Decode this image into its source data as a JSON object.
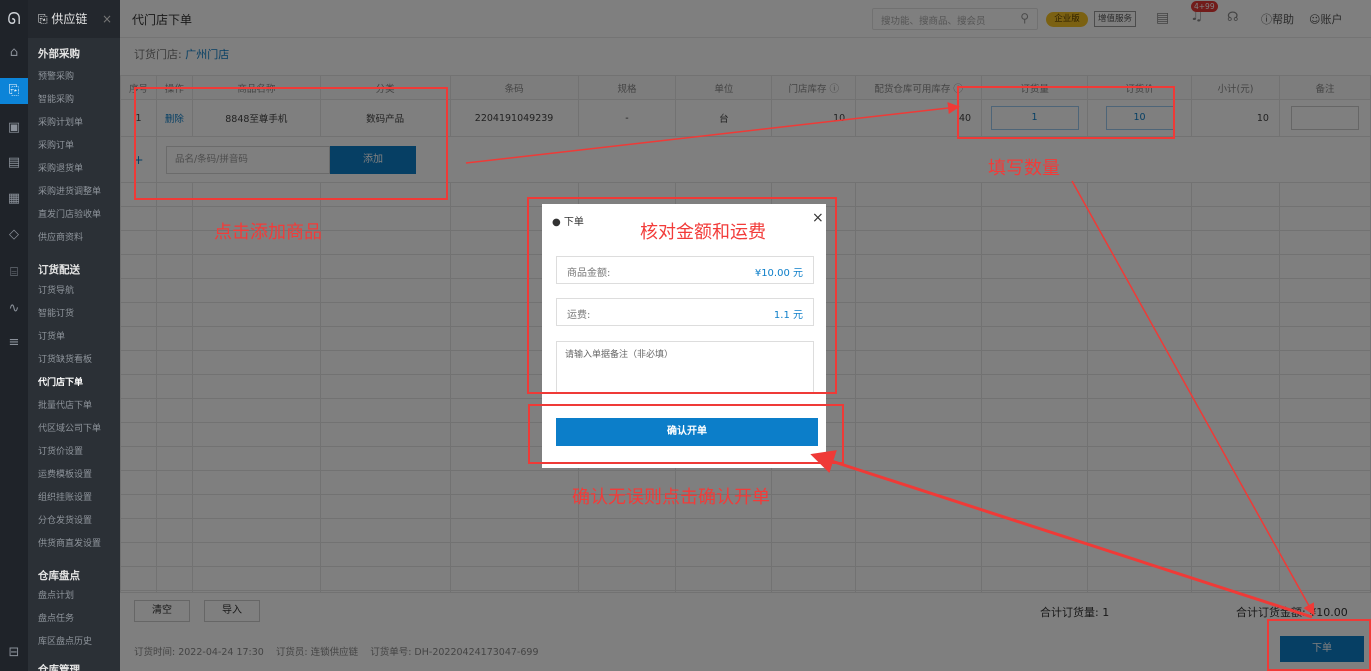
{
  "topbar": {
    "app_tab": "供应链",
    "page_title": "代门店下单",
    "search_placeholder": "搜功能、搜商品、搜会员",
    "edition_badge": "企业版",
    "value_added": "增值服务",
    "notif_badge": "4+99",
    "help": "帮助",
    "account": "账户"
  },
  "sidebar": {
    "groups": [
      {
        "title": "外部采购",
        "items": [
          "预警采购",
          "智能采购",
          "采购计划单",
          "采购订单",
          "采购退货单",
          "采购进货调整单",
          "直发门店验收单",
          "供应商资料"
        ]
      },
      {
        "title": "订货配送",
        "items": [
          "订货导航",
          "智能订货",
          "订货单",
          "订货缺货看板",
          "代门店下单",
          "批量代店下单",
          "代区域公司下单",
          "订货价设置",
          "运费模板设置",
          "组织挂账设置",
          "分仓发货设置",
          "供货商直发设置"
        ]
      },
      {
        "title": "仓库盘点",
        "items": [
          "盘点计划",
          "盘点任务",
          "库区盘点历史"
        ]
      },
      {
        "title": "仓库管理",
        "items": []
      }
    ],
    "active_item": "代门店下单"
  },
  "store": {
    "label": "订货门店:",
    "name": "广州门店"
  },
  "table": {
    "headers": [
      "序号",
      "操作",
      "商品名称",
      "分类",
      "条码",
      "规格",
      "单位",
      "门店库存",
      "配货仓库可用库存",
      "订货量",
      "订货价",
      "小计(元)",
      "备注"
    ],
    "row": {
      "index": "1",
      "action": "删除",
      "name": "8848至尊手机",
      "category": "数码产品",
      "barcode": "2204191049239",
      "spec": "-",
      "unit": "台",
      "store_stock": "10",
      "warehouse_stock": "40",
      "qty": "1",
      "price": "10",
      "subtotal": "10"
    },
    "add_plus": "+",
    "add_placeholder": "品名/条码/拼音码",
    "add_button": "添加"
  },
  "footer": {
    "clear": "清空",
    "import": "导入",
    "total_qty": "合计订货量: 1",
    "total_amount": "合计订货金额: ¥10.00",
    "meta": "订货时间: 2022-04-24 17:30    订货员: 连锁供应链    订货单号: DH-20220424173047-699",
    "submit": "下单"
  },
  "dialog": {
    "title": "下单",
    "close": "×",
    "goods_label": "商品金额:",
    "goods_value": "¥10.00 元",
    "freight_label": "运费:",
    "freight_value": "1.1 元",
    "remark_placeholder": "请输入单据备注（非必填）",
    "confirm": "确认开单"
  },
  "annotations": {
    "add_goods": "点击添加商品",
    "fill_qty": "填写数量",
    "check_amount": "核对金额和运费",
    "confirm_hint": "确认无误则点击确认开单"
  },
  "colors": {
    "accent": "#0c7ec9",
    "annotation": "#ef3a37"
  }
}
